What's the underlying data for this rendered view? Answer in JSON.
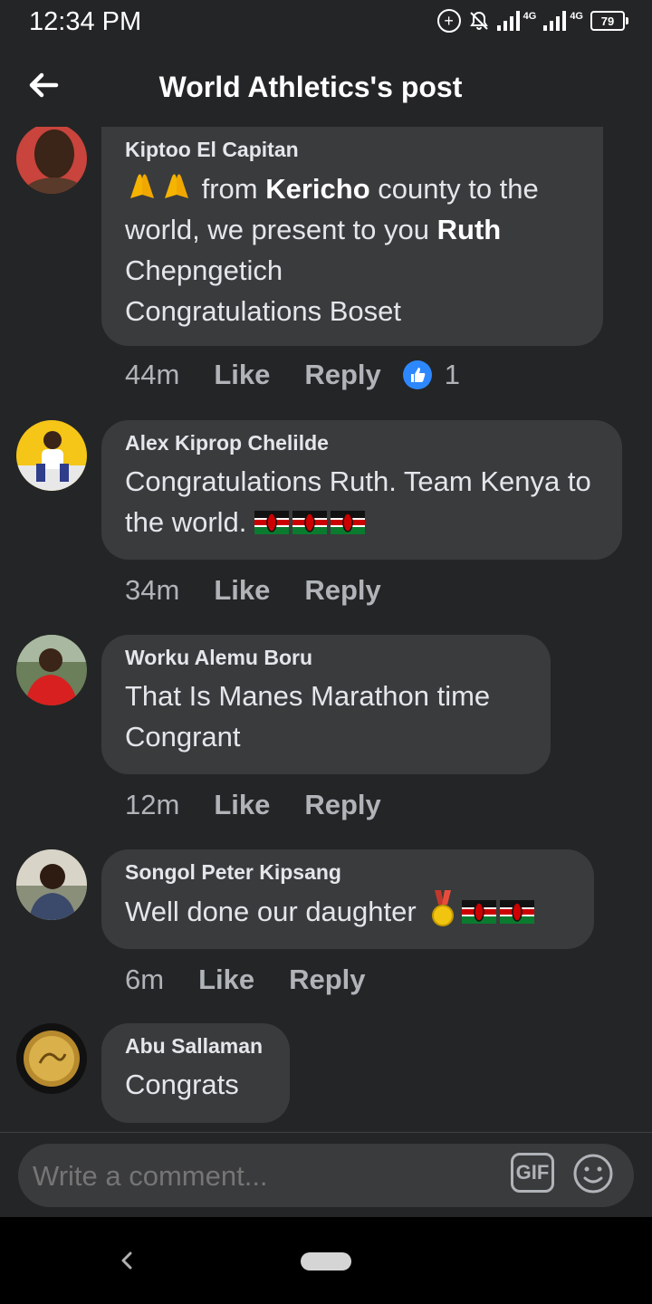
{
  "status_bar": {
    "time": "12:34 PM",
    "network_1": "4G",
    "network_2": "4G",
    "battery": "79"
  },
  "header": {
    "title": "World Athletics's post"
  },
  "comments": [
    {
      "author": "Kiptoo El Capitan",
      "text_pre": " from ",
      "text_bold_1": "Kericho",
      "text_mid": " county to the world, we present to you ",
      "text_bold_2": "Ruth",
      "text_post": " Chepngetich",
      "text_line2": "Congratulations Boset",
      "time": "44m",
      "like_label": "Like",
      "reply_label": "Reply",
      "reaction_count": "1"
    },
    {
      "author": "Alex Kiprop Chelilde",
      "text": "Congratulations Ruth. Team Kenya to the world. ",
      "time": "34m",
      "like_label": "Like",
      "reply_label": "Reply"
    },
    {
      "author": "Worku Alemu Boru",
      "text": "That Is Manes Marathon time Congrant",
      "time": "12m",
      "like_label": "Like",
      "reply_label": "Reply"
    },
    {
      "author": "Songol Peter Kipsang",
      "text": "Well done our daughter ",
      "time": "6m",
      "like_label": "Like",
      "reply_label": "Reply"
    },
    {
      "author": "Abu Sallaman",
      "text": "Congrats"
    }
  ],
  "composer": {
    "placeholder": "Write a comment...",
    "gif_label": "GIF"
  },
  "colors": {
    "background": "#242526",
    "bubble": "#3a3b3c",
    "like_blue": "#2d88ff",
    "muted_text": "#b0b3b8"
  }
}
